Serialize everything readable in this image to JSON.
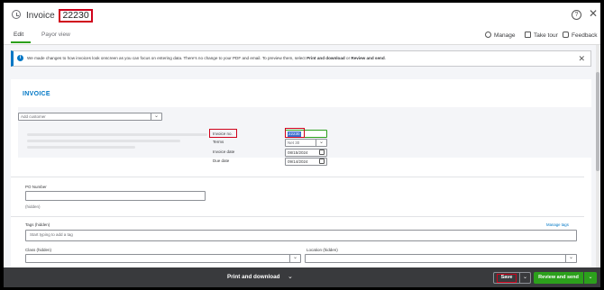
{
  "window": {
    "title": "Invoice",
    "invoice_number": "22230",
    "help_label": "?",
    "close_label": "✕"
  },
  "tabs": [
    {
      "label": "Edit"
    },
    {
      "label": "Payor view"
    }
  ],
  "toolbar": {
    "manage": "Manage",
    "take_tour": "Take tour",
    "feedback": "Feedback"
  },
  "notice": {
    "message_part1": "We made changes to how invoices look onscreen as you can focus on entering data. There's no change to your PDF and email. To preview them, select ",
    "message_bold1": "Print and download",
    "message_part2": " or ",
    "message_bold2": "Review and send",
    "message_part3": "."
  },
  "form": {
    "heading": "INVOICE",
    "customer_placeholder": "Add customer",
    "invoice_no_label": "Invoice no.",
    "invoice_no_value": "22230",
    "terms_label": "Terms",
    "terms_value": "Net 30",
    "invoice_date_label": "Invoice date",
    "invoice_date_value": "08/15/2024",
    "due_date_label": "Due date",
    "due_date_value": "09/14/2024",
    "po_label": "PO Number",
    "po_hint": "(hidden)",
    "tags_label": "Tags (hidden)",
    "tags_placeholder": "Start typing to add a tag",
    "manage_tags": "Manage tags",
    "class_label": "Class (hidden)",
    "location_label": "Location (hidden)"
  },
  "bottom": {
    "print": "Print and download",
    "save": "Save",
    "review": "Review and send"
  },
  "colors": {
    "accent_green": "#2ca01c",
    "link_blue": "#0077c5",
    "highlight_red": "#d0021b",
    "bar_dark": "#393a3d"
  }
}
